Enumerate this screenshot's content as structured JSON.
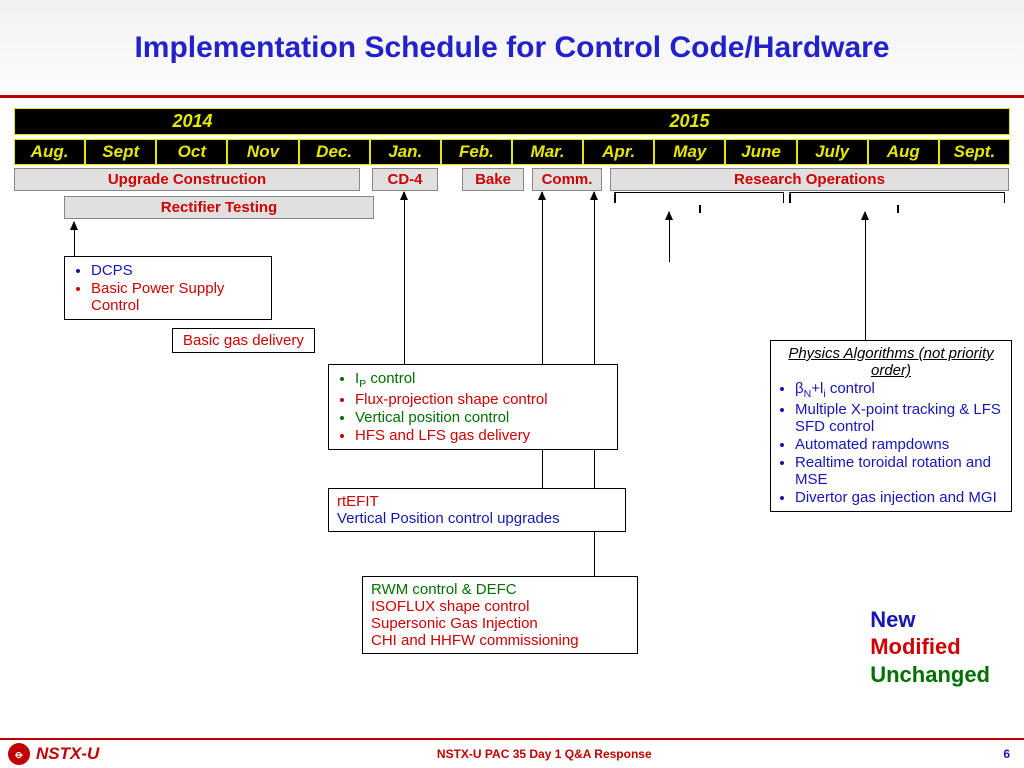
{
  "title": "Implementation Schedule for Control Code/Hardware",
  "years": [
    {
      "label": "2014",
      "span": 5
    },
    {
      "label": "2015",
      "span": 9
    }
  ],
  "months": [
    "Aug.",
    "Sept",
    "Oct",
    "Nov",
    "Dec.",
    "Jan.",
    "Feb.",
    "Mar.",
    "Apr.",
    "May",
    "June",
    "July",
    "Aug",
    "Sept."
  ],
  "bars": {
    "upgrade": "Upgrade Construction",
    "cd4": "CD-4",
    "bake": "Bake",
    "comm": "Comm.",
    "research": "Research Operations",
    "rectifier": "Rectifier Testing"
  },
  "callouts": {
    "dcps": [
      {
        "text": "DCPS",
        "cls": "c-new"
      },
      {
        "text": "Basic Power Supply Control",
        "cls": "c-mod"
      }
    ],
    "gas": "Basic gas delivery",
    "jan_block": [
      {
        "html": "I<sub>P</sub> control",
        "cls": "c-unc"
      },
      {
        "text": "Flux-projection shape control",
        "cls": "c-mod"
      },
      {
        "text": "Vertical position control",
        "cls": "c-unc"
      },
      {
        "text": "HFS and LFS gas delivery",
        "cls": "c-mod"
      }
    ],
    "rtefit": [
      {
        "text": "rtEFIT",
        "cls": "c-mod"
      },
      {
        "text": "Vertical Position control upgrades",
        "cls": "c-new"
      }
    ],
    "rwm": [
      {
        "text": "RWM control & DEFC",
        "cls": "c-unc"
      },
      {
        "text": "ISOFLUX shape control",
        "cls": "c-mod"
      },
      {
        "text": "Supersonic Gas Injection",
        "cls": "c-mod"
      },
      {
        "text": "CHI and HHFW commissioning",
        "cls": "c-mod"
      }
    ],
    "physics_title": "Physics Algorithms (not priority order)",
    "physics": [
      {
        "html": "β<sub>N</sub>+l<sub>i</sub> control",
        "cls": "c-new"
      },
      {
        "text": "Multiple X-point tracking & LFS SFD control",
        "cls": "c-new"
      },
      {
        "text": "Automated rampdowns",
        "cls": "c-new"
      },
      {
        "text": "Realtime toroidal rotation and MSE",
        "cls": "c-new"
      },
      {
        "text": "Divertor gas injection and MGI",
        "cls": "c-new"
      }
    ]
  },
  "legend": {
    "new": "New",
    "mod": "Modified",
    "unc": "Unchanged"
  },
  "footer": {
    "name": "NSTX-U",
    "mid": "NSTX-U PAC 35 Day 1 Q&A Response",
    "page": "6"
  }
}
